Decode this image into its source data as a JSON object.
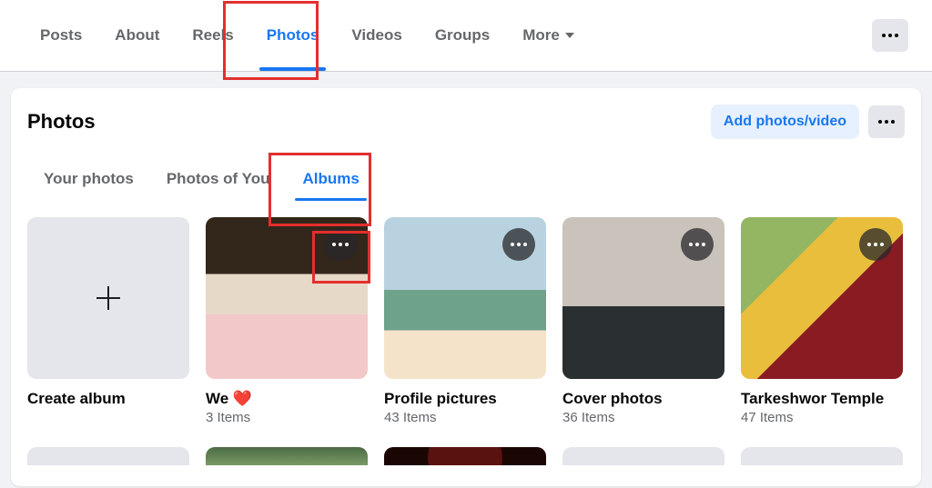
{
  "profile_tabs": {
    "items": [
      {
        "label": "Posts"
      },
      {
        "label": "About"
      },
      {
        "label": "Reels"
      },
      {
        "label": "Photos"
      },
      {
        "label": "Videos"
      },
      {
        "label": "Groups"
      }
    ],
    "more_label": "More"
  },
  "photos_section": {
    "title": "Photos",
    "add_label": "Add photos/video",
    "subtabs": [
      {
        "label": "Your photos"
      },
      {
        "label": "Photos of You"
      },
      {
        "label": "Albums"
      }
    ],
    "create_album_label": "Create album",
    "albums": [
      {
        "title": "We ❤️",
        "count": "3 Items"
      },
      {
        "title": "Profile pictures",
        "count": "43 Items"
      },
      {
        "title": "Cover photos",
        "count": "36 Items"
      },
      {
        "title": "Tarkeshwor Temple",
        "count": "47 Items"
      }
    ]
  }
}
